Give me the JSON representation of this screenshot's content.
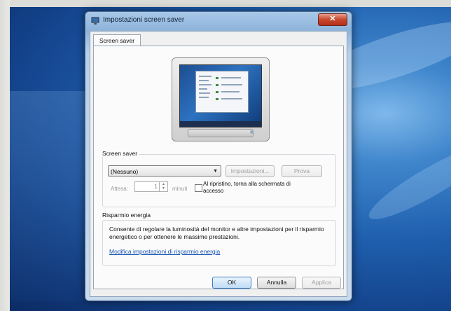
{
  "window": {
    "title": "Impostazioni screen saver",
    "close_label": "✕"
  },
  "tab": {
    "label": "Screen saver"
  },
  "screensaver": {
    "group_label": "Screen saver",
    "selected": "(Nessuno)",
    "settings_button": "Impostazioni...",
    "preview_button": "Prova",
    "wait_label": "Attesa:",
    "wait_value": "1",
    "minutes_label": "minuti",
    "resume_label": "Al ripristino, torna alla schermata di accesso",
    "resume_checked": false
  },
  "energy": {
    "title": "Risparmio energia",
    "description": "Consente di regolare la luminosità del monitor e altre impostazioni per il risparmio energetico o per ottenere le massime prestazioni.",
    "link": "Modifica impostazioni di risparmio energia"
  },
  "buttons": {
    "ok": "OK",
    "cancel": "Annulla",
    "apply": "Applica"
  },
  "colors": {
    "desktop": "#1f5fae",
    "close_button": "#c8462c",
    "link": "#1a55b5"
  }
}
